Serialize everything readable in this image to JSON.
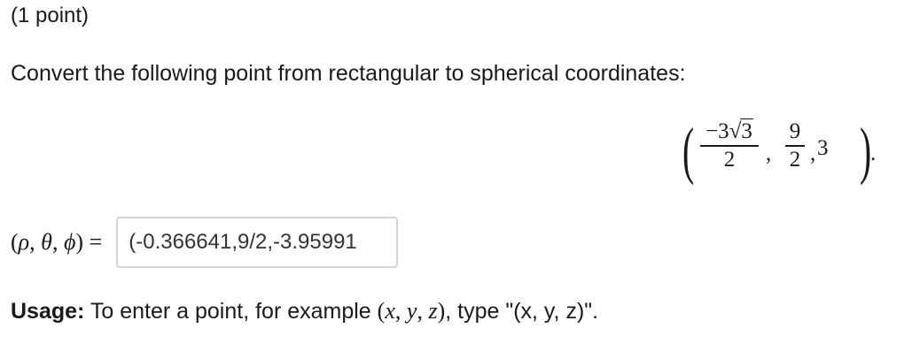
{
  "problem": {
    "points_label": "(1 point)",
    "prompt": "Convert the following point from rectangular to spherical coordinates:",
    "point": {
      "open_paren": "(",
      "close_paren": ")",
      "x_numerator_coef": "−3",
      "x_numerator_radicand": "3",
      "x_denominator": "2",
      "sep1": ",",
      "y_numerator": "9",
      "y_denominator": "2",
      "sep2": ",",
      "z": "3",
      "end_dot": "."
    }
  },
  "answer": {
    "label_open": "(",
    "rho": "ρ",
    "sep1": ", ",
    "theta": "θ",
    "sep2": ", ",
    "phi": "ϕ",
    "label_close": ")",
    "equals": " =",
    "value": "(-0.366641,9/2,-3.95991"
  },
  "usage": {
    "label": "Usage:",
    "text_before": " To enter a point, for example ",
    "example_open": "(",
    "x": "x",
    "comma1": ", ",
    "y": "y",
    "comma2": ", ",
    "z": "z",
    "example_close": ")",
    "text_after": ", type \"(x, y, z)\"."
  }
}
